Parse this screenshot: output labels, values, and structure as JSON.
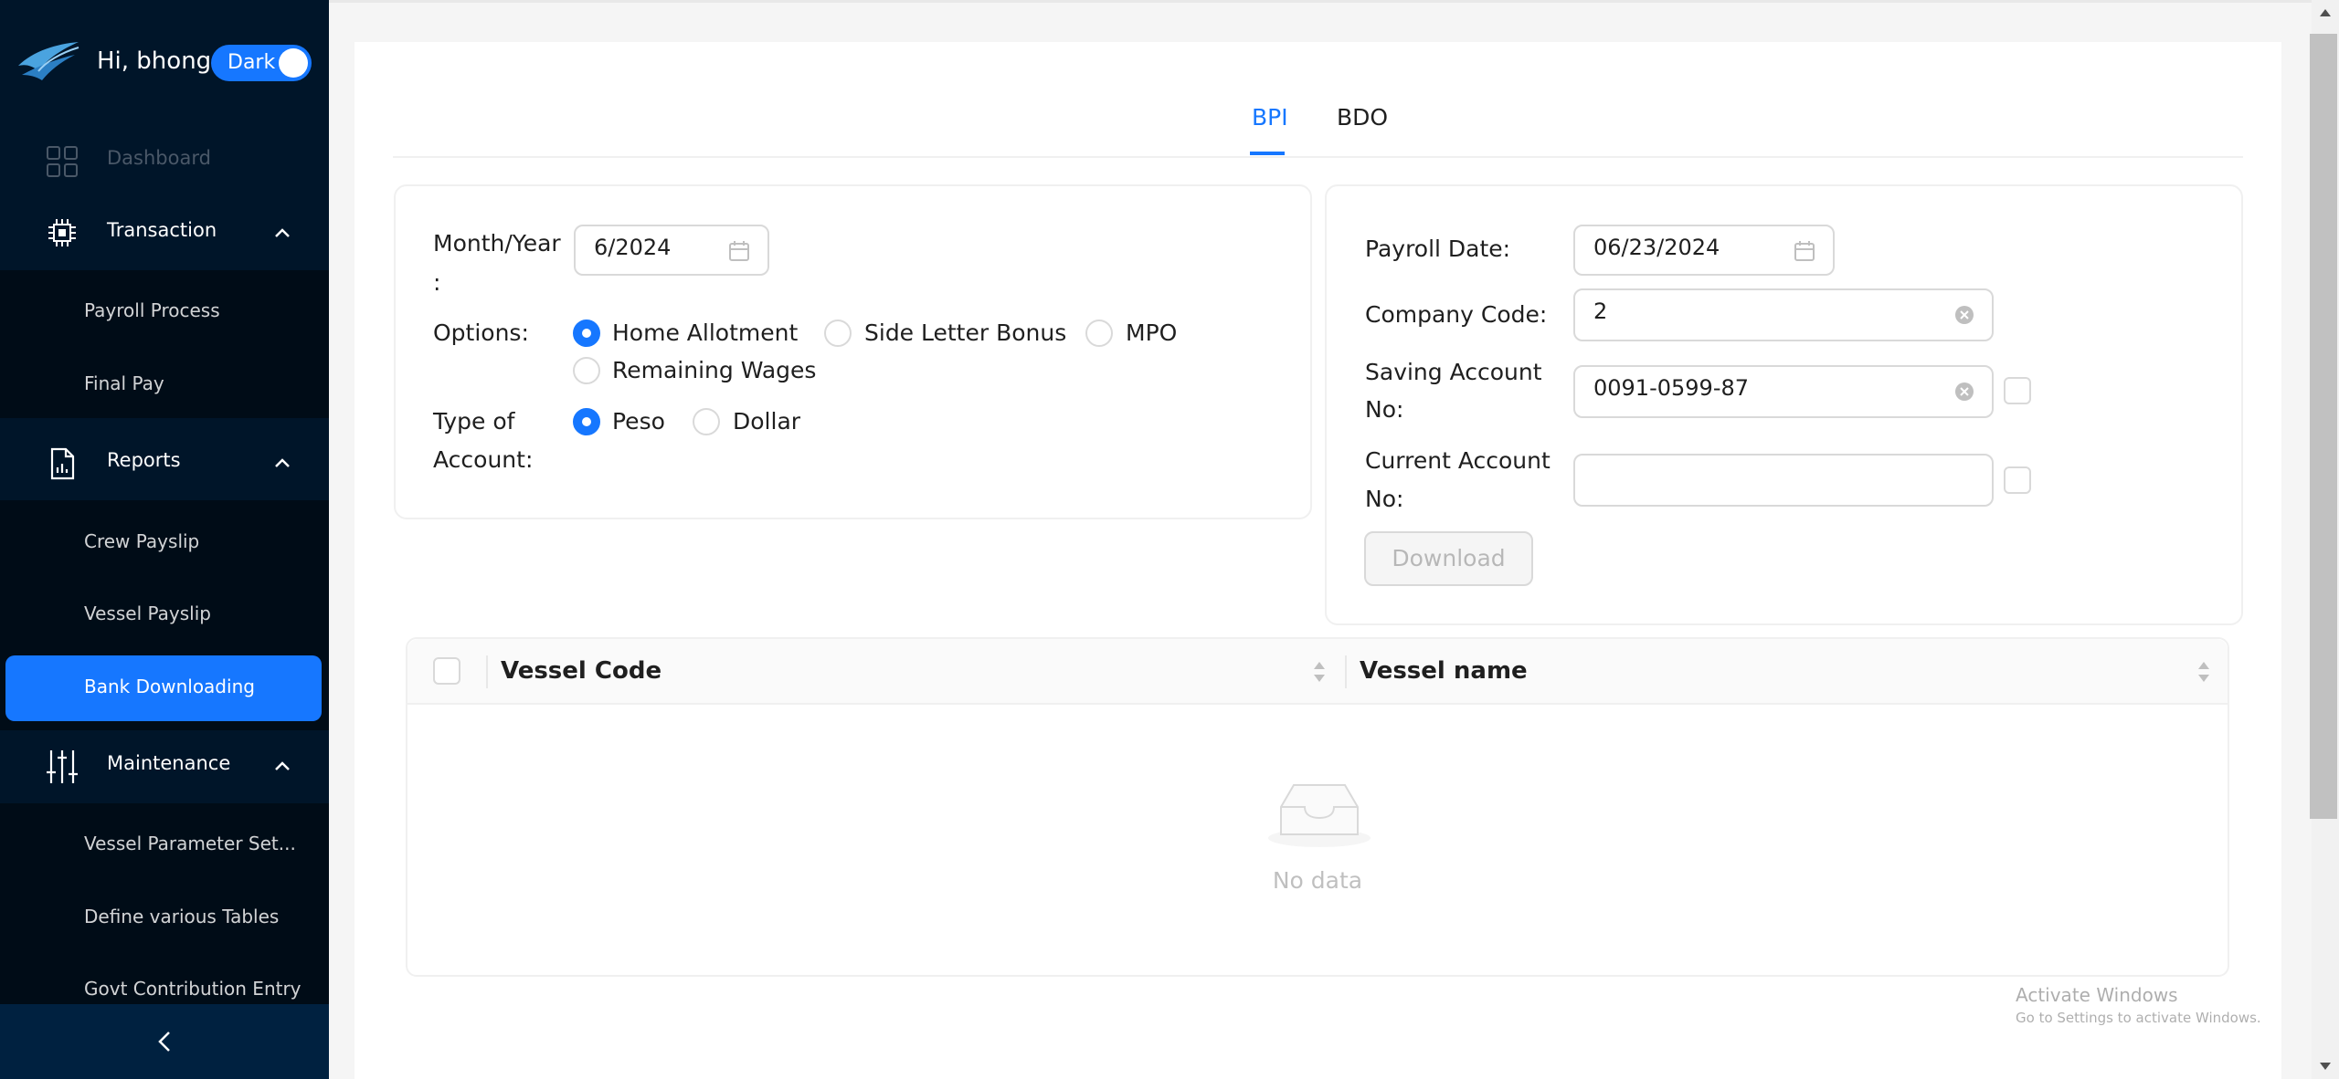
{
  "sidebar": {
    "greeting": "Hi, bhong",
    "theme_toggle": "Dark",
    "menu": {
      "dashboard": "Dashboard",
      "transaction": "Transaction",
      "reports": "Reports",
      "maintenance": "Maintenance"
    },
    "transaction_items": [
      "Payroll Process",
      "Final Pay"
    ],
    "reports_items": [
      "Crew Payslip",
      "Vessel Payslip",
      "Bank Downloading"
    ],
    "maintenance_items": [
      "Vessel Parameter Set...",
      "Define various Tables",
      "Govt Contribution Entry"
    ]
  },
  "tabs": [
    "BPI",
    "BDO"
  ],
  "form": {
    "month_year_label": "Month/Year\n:",
    "month_year_label_line1": "Month/Year",
    "month_year_label_line2": ":",
    "month_year_value": "6/2024",
    "options_label": "Options:",
    "options": [
      "Home Allotment",
      "Side Letter Bonus",
      "MPO",
      "Remaining Wages"
    ],
    "options_selected": "Home Allotment",
    "type_label_line1": "Type of",
    "type_label_line2": "Account:",
    "account_types": [
      "Peso",
      "Dollar"
    ],
    "account_selected": "Peso",
    "payroll_date_label": "Payroll Date:",
    "payroll_date_value": "06/23/2024",
    "company_code_label": "Company Code:",
    "company_code_value": "2",
    "saving_label_line1": "Saving Account",
    "saving_label_line2": "No:",
    "saving_value": "0091-0599-87",
    "current_label_line1": "Current Account",
    "current_label_line2": "No:",
    "current_value": "",
    "download_label": "Download"
  },
  "table": {
    "columns": [
      "Vessel Code",
      "Vessel name"
    ],
    "empty_text": "No data"
  },
  "watermark": {
    "line1": "Activate Windows",
    "line2": "Go to Settings to activate Windows."
  },
  "colors": {
    "sidebar_bg": "#001529",
    "accent": "#1677ff"
  }
}
